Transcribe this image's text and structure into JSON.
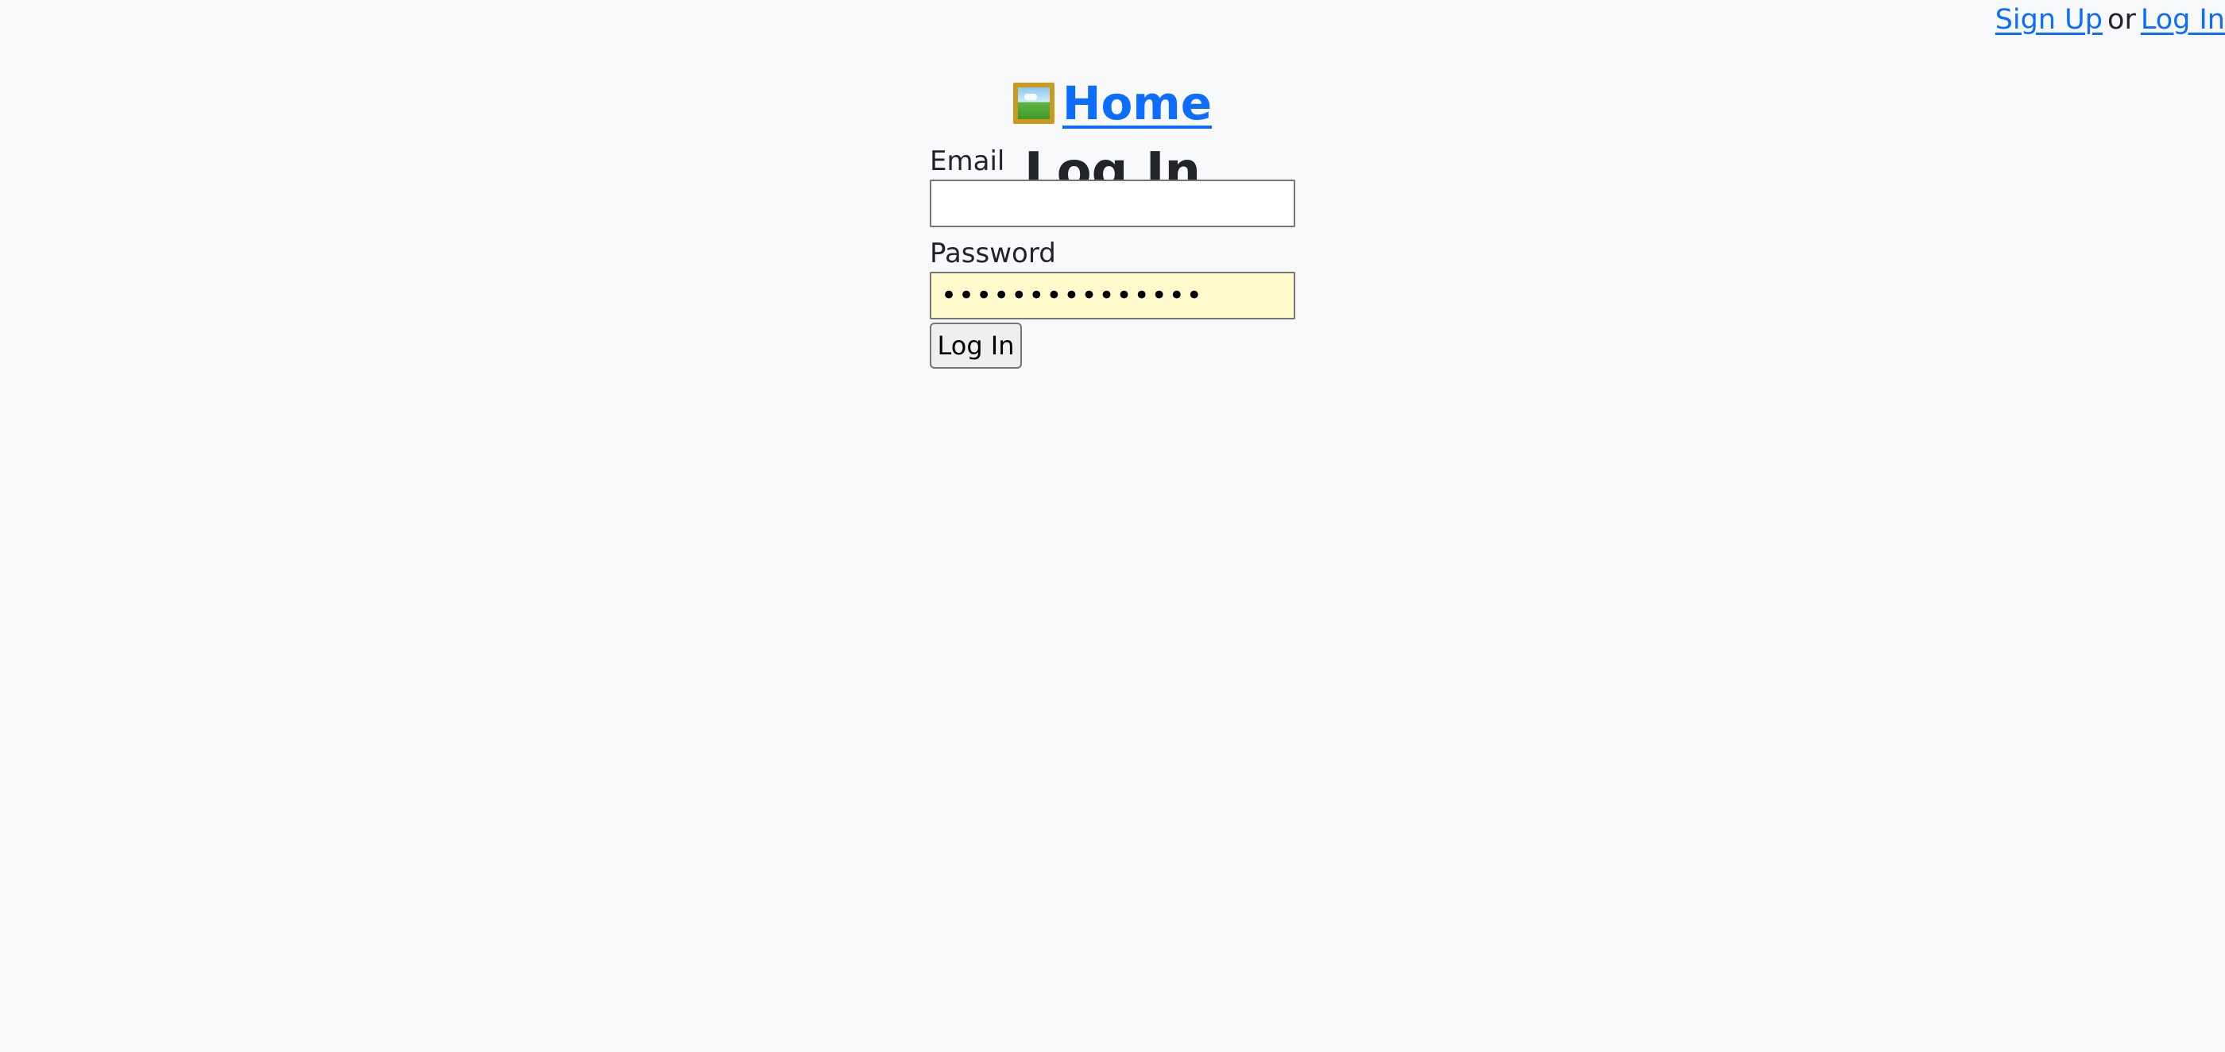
{
  "topnav": {
    "signup_label": "Sign Up",
    "separator": "or",
    "login_label": "Log In"
  },
  "home": {
    "icon": "framed-picture-icon",
    "label": "Home"
  },
  "page": {
    "title": "Log In"
  },
  "form": {
    "email_label": "Email",
    "email_value": "",
    "password_label": "Password",
    "password_value": "•••••••••••••••",
    "submit_label": "Log In"
  },
  "colors": {
    "link": "#0d6efd",
    "background": "#f8f9fa",
    "autofill": "#fffbcc"
  }
}
